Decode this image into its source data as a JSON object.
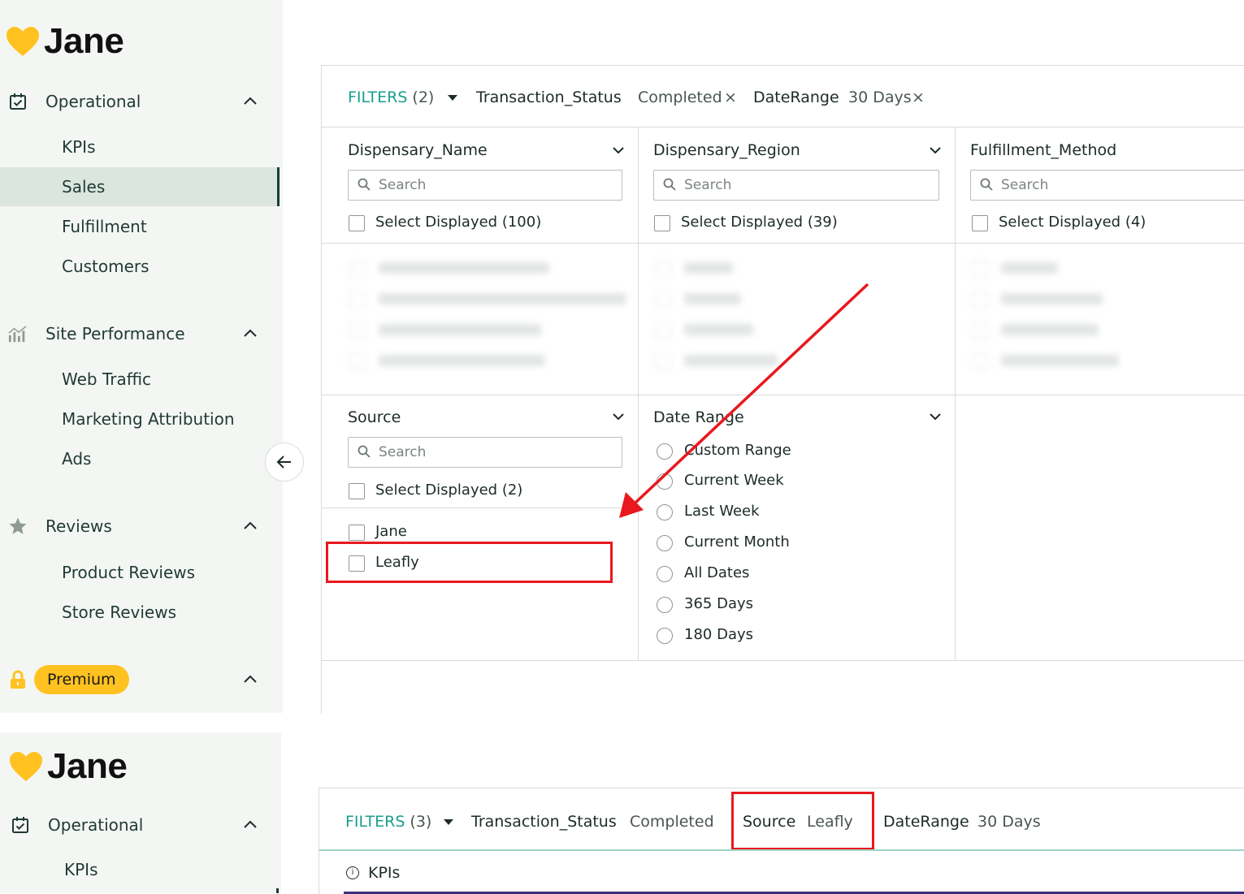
{
  "top": {
    "brand": "Jane",
    "sections": {
      "operational": "Operational",
      "site_performance": "Site Performance",
      "reviews": "Reviews",
      "premium": "Premium"
    },
    "nav": {
      "kpis": "KPIs",
      "sales": "Sales",
      "fulfillment": "Fulfillment",
      "customers": "Customers",
      "web_traffic": "Web Traffic",
      "marketing_attribution": "Marketing Attribution",
      "ads": "Ads",
      "product_reviews": "Product Reviews",
      "store_reviews": "Store Reviews"
    },
    "filters_bar": {
      "filters_label": "FILTERS",
      "filters_count": "(2)",
      "f1_name": "Transaction_Status",
      "f1_value": "Completed",
      "f2_name": "DateRange",
      "f2_value": "30 Days",
      "remove_glyph": "×"
    },
    "columns": {
      "dispensary_name": {
        "title": "Dispensary_Name",
        "search_placeholder": "Search",
        "select_all": "Select Displayed (100)"
      },
      "dispensary_region": {
        "title": "Dispensary_Region",
        "search_placeholder": "Search",
        "select_all": "Select Displayed (39)"
      },
      "fulfillment_method": {
        "title": "Fulfillment_Method",
        "search_placeholder": "Search",
        "select_all": "Select Displayed (4)"
      },
      "source": {
        "title": "Source",
        "search_placeholder": "Search",
        "select_all": "Select Displayed (2)",
        "options": [
          "Jane",
          "Leafly"
        ]
      },
      "date_range": {
        "title": "Date Range",
        "options": [
          "Custom Range",
          "Current Week",
          "Last Week",
          "Current Month",
          "All Dates",
          "365 Days",
          "180 Days"
        ]
      }
    }
  },
  "bottom": {
    "brand": "Jane",
    "section": "Operational",
    "nav_kpis": "KPIs",
    "filters_bar": {
      "filters_label": "FILTERS",
      "filters_count": "(3)",
      "f1_name": "Transaction_Status",
      "f1_value": "Completed",
      "f2_name": "Source",
      "f2_value": "Leafly",
      "f3_name": "DateRange",
      "f3_value": "30 Days"
    },
    "section_title": "KPIs"
  },
  "colors": {
    "accent_teal": "#1a9e8f",
    "premium_yellow": "#ffc220",
    "highlight_red": "#e8181e",
    "brand_heart": "#ffc220"
  }
}
